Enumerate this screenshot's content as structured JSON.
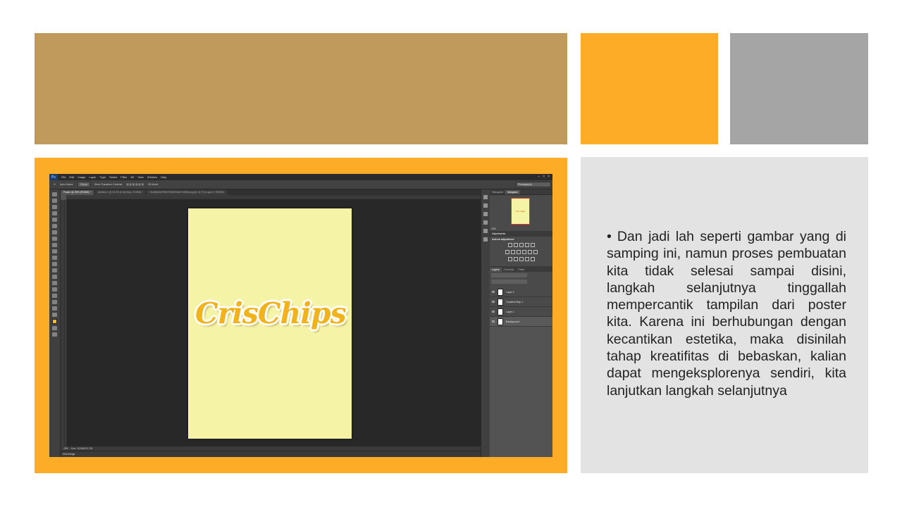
{
  "colors": {
    "tan_block": "#bf9a5c",
    "orange_block": "#fdac28",
    "gray_block": "#a5a5a5",
    "text_panel_bg": "#e3e3e3",
    "poster_bg": "#f5f3a5",
    "logo_color": "#f1b21a"
  },
  "text_panel": {
    "bullet": "Dan jadi lah seperti gambar yang di samping ini, namun  proses pembuatan kita tidak selesai sampai disini, langkah selanjutnya tinggallah mempercantik tampilan dari poster kita. Karena ini berhubungan dengan kecantikan estetika, maka disinilah tahap kreatifitas di bebaskan,  kalian dapat mengeksplorenya sendiri, kita lanjutkan langkah selanjutnya"
  },
  "photoshop": {
    "logo": "Ps",
    "menu": [
      "File",
      "Edit",
      "Image",
      "Layer",
      "Type",
      "Select",
      "Filter",
      "3D",
      "View",
      "Window",
      "Help"
    ],
    "options": {
      "auto_select": "Auto-Select:",
      "auto_select_value": "Group",
      "transform_controls": "Show Transform Controls",
      "mode_3d": "3D Mode:"
    },
    "workspace": "Photography",
    "tabs": [
      "Poster @ 25% (RGB/8) *",
      "Untitled-1 @ 33,3% (CrisChips, RGB/8) *",
      "f1b48d93d7f59b752667b9d47e56fd.png @ 16,7% (Layer 0, RGB/8)"
    ],
    "poster_logo": "CrisChips",
    "status_zoom": "25%",
    "status_doc": "Doc: 24,9M/111,7M",
    "mini_bridge": "Mini Bridge",
    "panels": {
      "histogram_tab": "Histogram",
      "navigator_tab": "Navigator",
      "navigator_thumb": "Cris Chips",
      "navigator_zoom": "25%",
      "adjustments_tab": "Adjustments",
      "add_adjustment": "Add an adjustment",
      "layers_tab": "Layers",
      "channels_tab": "Channels",
      "paths_tab": "Paths",
      "layers": [
        {
          "name": "Layer 2"
        },
        {
          "name": "Gradient Map 1"
        },
        {
          "name": "Layer 1"
        },
        {
          "name": "Background"
        }
      ]
    }
  }
}
